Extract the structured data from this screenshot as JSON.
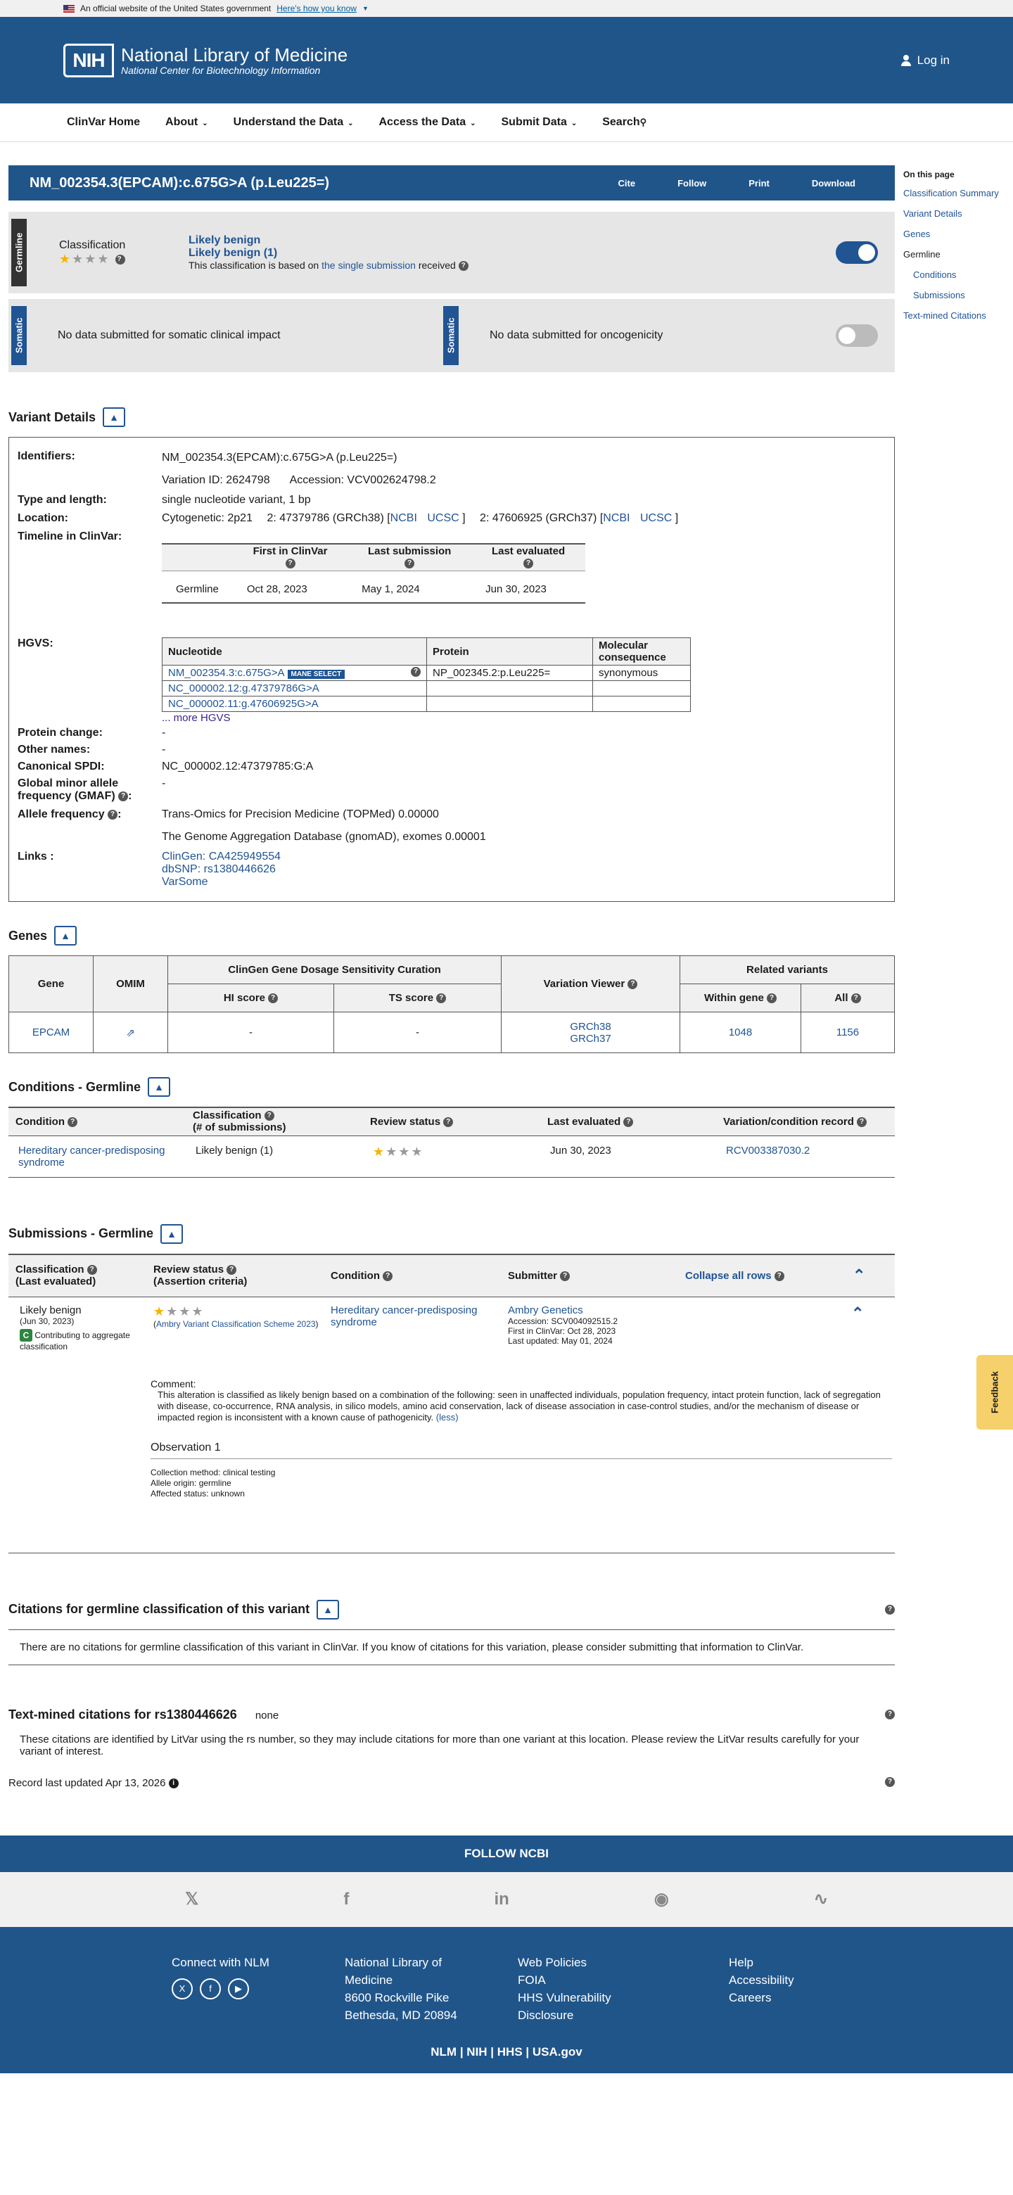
{
  "gov_banner": {
    "text": "An official website of the United States government",
    "link": "Here's how you know"
  },
  "header": {
    "logo": "NIH",
    "title": "National Library of Medicine",
    "subtitle": "National Center for Biotechnology Information",
    "login": "Log in"
  },
  "nav": {
    "items": [
      "ClinVar Home",
      "About",
      "Understand the Data",
      "Access the Data",
      "Submit Data",
      "Search"
    ]
  },
  "sidebar": {
    "title": "On this page",
    "items": [
      "Classification Summary",
      "Variant Details",
      "Genes",
      "Germline",
      "Conditions",
      "Submissions",
      "Text-mined Citations"
    ]
  },
  "title_bar": {
    "title": "NM_002354.3(EPCAM):c.675G>A (p.Leu225=)",
    "actions": [
      "Cite",
      "Follow",
      "Print",
      "Download"
    ]
  },
  "germline": {
    "tag": "Germline",
    "label": "Classification",
    "class1": "Likely benign",
    "class2": "Likely benign (1)",
    "based_pre": "This classification is based on",
    "based_link": "the single submission",
    "based_post": "received"
  },
  "somatic": {
    "tag": "Somatic",
    "clinical": "No data submitted for somatic clinical impact",
    "onco": "No data submitted for oncogenicity"
  },
  "variant_details": {
    "heading": "Variant Details",
    "identifiers_k": "Identifiers:",
    "identifiers_v": "NM_002354.3(EPCAM):c.675G>A (p.Leu225=)",
    "variation_id": "Variation ID: 2624798",
    "accession": "Accession: VCV002624798.2",
    "type_k": "Type and length:",
    "type_v": "single nucleotide variant, 1 bp",
    "location_k": "Location:",
    "cyto": "Cytogenetic: 2p21",
    "loc38": "2: 47379786 (GRCh38) [",
    "loc37": "2: 47606925 (GRCh37) [",
    "ncbi": "NCBI",
    "ucsc": "UCSC",
    "close_br": "]",
    "timeline_k": "Timeline in ClinVar:",
    "timeline_headers": [
      "First in ClinVar",
      "Last submission",
      "Last evaluated"
    ],
    "timeline_row": [
      "Germline",
      "Oct 28, 2023",
      "May 1, 2024",
      "Jun 30, 2023"
    ],
    "hgvs_k": "HGVS:",
    "hgvs_headers": [
      "Nucleotide",
      "Protein",
      "Molecular consequence"
    ],
    "hgvs_rows": [
      [
        "NM_002354.3:c.675G>A",
        "NP_002345.2:p.Leu225=",
        "synonymous"
      ],
      [
        "NC_000002.12:g.47379786G>A",
        "",
        ""
      ],
      [
        "NC_000002.11:g.47606925G>A",
        "",
        ""
      ]
    ],
    "mane": "MANE SELECT",
    "more_hgvs": "... more HGVS",
    "protein_k": "Protein change:",
    "protein_v": "-",
    "other_k": "Other names:",
    "other_v": "-",
    "spdi_k": "Canonical SPDI:",
    "spdi_v": "NC_000002.12:47379785:G:A",
    "gmaf_k": "Global minor allele frequency (GMAF)",
    "gmaf_colon": ":",
    "gmaf_v": "-",
    "af_k": "Allele frequency",
    "af_colon": ":",
    "af_v1": "Trans-Omics for Precision Medicine (TOPMed) 0.00000",
    "af_v2": "The Genome Aggregation Database (gnomAD), exomes 0.00001",
    "links_k": "Links :",
    "links": [
      "ClinGen: CA425949554",
      "dbSNP: rs1380446626",
      "VarSome"
    ]
  },
  "genes": {
    "heading": "Genes",
    "h_gene": "Gene",
    "h_omim": "OMIM",
    "h_clingen": "ClinGen Gene Dosage Sensitivity Curation",
    "h_viewer": "Variation Viewer",
    "h_related": "Related variants",
    "h_hi": "HI score",
    "h_ts": "TS score",
    "h_within": "Within gene",
    "h_all": "All",
    "row": {
      "gene": "EPCAM",
      "hi": "-",
      "ts": "-",
      "grch38": "GRCh38",
      "grch37": "GRCh37",
      "within": "1048",
      "all": "1156"
    }
  },
  "conditions": {
    "heading": "Conditions - Germline",
    "headers": [
      "Condition",
      "Classification",
      "(# of submissions)",
      "Review status",
      "Last evaluated",
      "Variation/condition record"
    ],
    "row": {
      "condition": "Hereditary cancer-predisposing syndrome",
      "classification": "Likely benign (1)",
      "evaluated": "Jun 30, 2023",
      "record": "RCV003387030.2"
    }
  },
  "submissions": {
    "heading": "Submissions - Germline",
    "h_class": "Classification",
    "h_class2": "(Last evaluated)",
    "h_review": "Review status",
    "h_review2": "(Assertion criteria)",
    "h_condition": "Condition",
    "h_submitter": "Submitter",
    "collapse": "Collapse all rows",
    "row": {
      "class": "Likely benign",
      "date": "(Jun 30, 2023)",
      "badge": "C",
      "contrib": "Contributing to aggregate classification",
      "criteria": "Ambry Variant Classification Scheme 2023",
      "paren_open": "(",
      "paren_close": ")",
      "condition": "Hereditary cancer-predisposing syndrome",
      "submitter": "Ambry Genetics",
      "accession": "Accession: SCV004092515.2",
      "first": "First in ClinVar: Oct 28, 2023",
      "updated": "Last updated: May 01, 2024"
    },
    "comment_label": "Comment:",
    "comment": "This alteration is classified as likely benign based on a combination of the following: seen in unaffected individuals, population frequency, intact protein function, lack of segregation with disease, co-occurrence, RNA analysis, in silico models, amino acid conservation, lack of disease association in case-control studies, and/or the mechanism of disease or impacted region is inconsistent with a known cause of pathogenicity.",
    "less": "(less)",
    "observation": "Observation 1",
    "obs_lines": [
      "Collection method: clinical testing",
      "Allele origin: germline",
      "Affected status: unknown"
    ]
  },
  "citations": {
    "heading": "Citations for germline classification of this variant",
    "text": "There are no citations for germline classification of this variant in ClinVar. If you know of citations for this variation, please consider submitting that information to ClinVar."
  },
  "textmined": {
    "heading": "Text-mined citations for rs1380446626",
    "none": "none",
    "text": "These citations are identified by LitVar using the rs number, so they may include citations for more than one variant at this location. Please review the LitVar results carefully for your variant of interest."
  },
  "record_updated": "Record last updated Apr 13, 2026",
  "feedback": "Feedback",
  "follow": "FOLLOW NCBI",
  "social_icons": [
    "x-icon",
    "facebook-icon",
    "linkedin-icon",
    "github-icon",
    "rss-icon"
  ],
  "footer": {
    "connect": "Connect with NLM",
    "address": [
      "National Library of",
      "Medicine",
      "8600 Rockville Pike",
      "Bethesda, MD 20894"
    ],
    "policies": [
      "Web Policies",
      "FOIA",
      "HHS Vulnerability",
      "Disclosure"
    ],
    "help": [
      "Help",
      "Accessibility",
      "Careers"
    ],
    "bottom": [
      "NLM",
      "NIH",
      "HHS",
      "USA.gov"
    ]
  }
}
